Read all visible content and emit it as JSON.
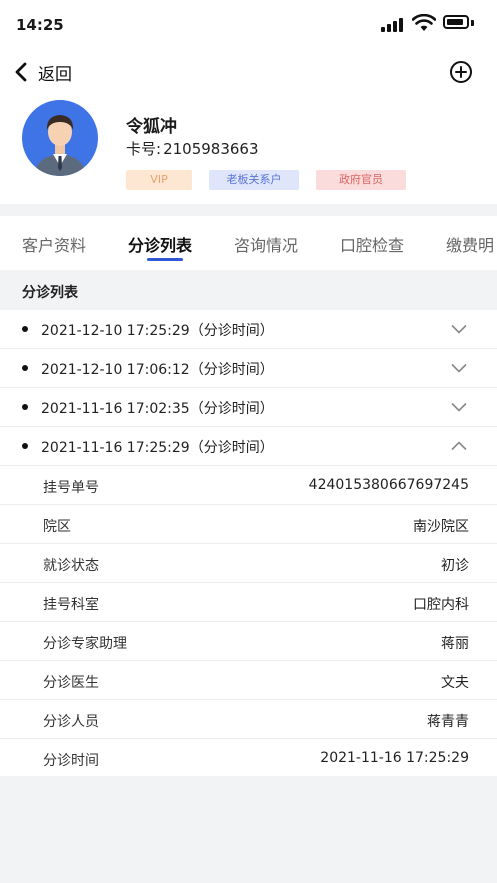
{
  "status_bar": {
    "time": "14:25"
  },
  "nav": {
    "back_label": "返回"
  },
  "profile": {
    "name": "令狐冲",
    "card_label": "卡号:",
    "card_number": "2105983663",
    "tags": [
      "VIP",
      "老板关系户",
      "政府官员"
    ]
  },
  "tabs": [
    "客户资料",
    "分诊列表",
    "咨询情况",
    "口腔检查",
    "缴费明"
  ],
  "active_tab": "分诊列表",
  "section": {
    "title": "分诊列表"
  },
  "triage_list": [
    {
      "text": "2021-12-10 17:25:29（分诊时间）",
      "expanded": false
    },
    {
      "text": "2021-12-10 17:06:12（分诊时间）",
      "expanded": false
    },
    {
      "text": "2021-11-16 17:02:35（分诊时间）",
      "expanded": false
    },
    {
      "text": "2021-11-16 17:25:29（分诊时间）",
      "expanded": true
    }
  ],
  "details": [
    {
      "label": "挂号单号",
      "value": "424015380667697245"
    },
    {
      "label": "院区",
      "value": "南沙院区"
    },
    {
      "label": "就诊状态",
      "value": "初诊"
    },
    {
      "label": "挂号科室",
      "value": "口腔内科"
    },
    {
      "label": "分诊专家助理",
      "value": "蒋丽"
    },
    {
      "label": "分诊医生",
      "value": "文夫"
    },
    {
      "label": "分诊人员",
      "value": "蒋青青"
    },
    {
      "label": "分诊时间",
      "value": "2021-11-16 17:25:29"
    }
  ],
  "colors": {
    "accent": "#2f57d8",
    "avatar_bg": "#3f74e6",
    "band": "#f2f3f5"
  }
}
